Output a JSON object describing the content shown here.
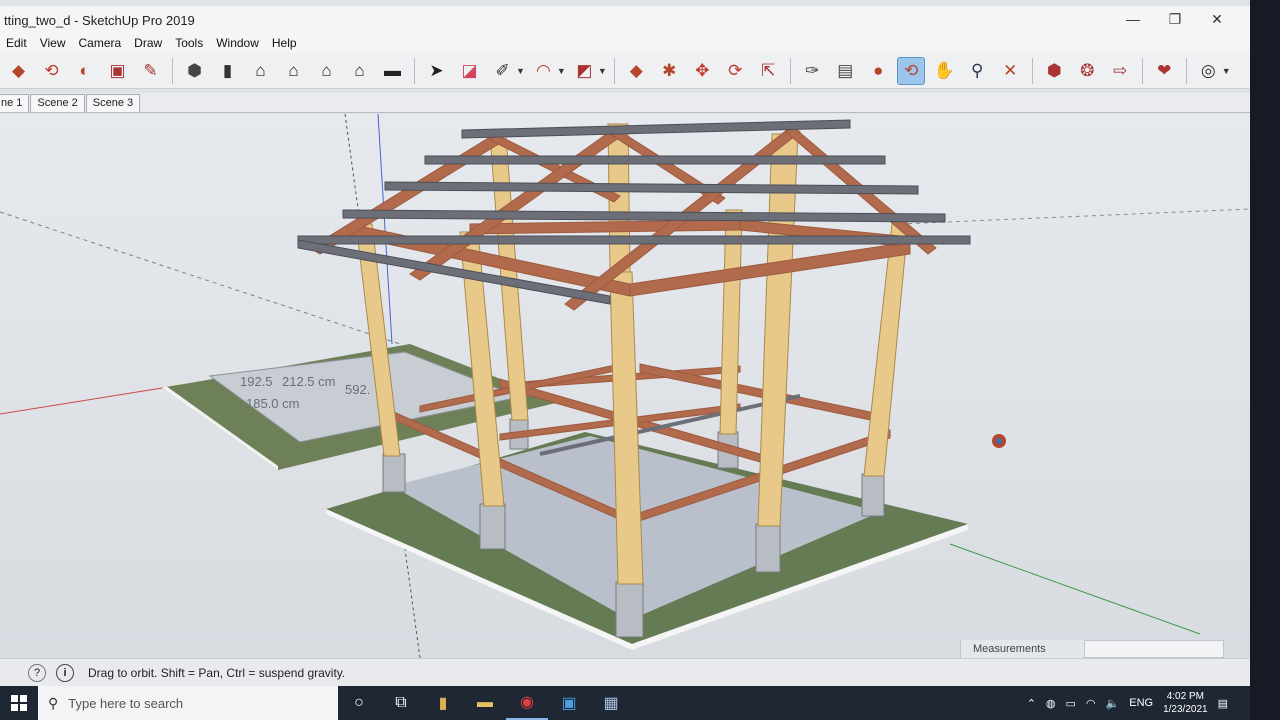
{
  "window": {
    "title": "tting_two_d - SketchUp Pro 2019",
    "controls": [
      "—",
      "❐",
      "✕"
    ]
  },
  "menu": [
    "Edit",
    "View",
    "Camera",
    "Draw",
    "Tools",
    "Window",
    "Help"
  ],
  "toolbar": {
    "icons": [
      "paint-bucket-icon",
      "eraser-icon",
      "pencil-line-icon",
      "arc-icon",
      "rectangle-icon",
      "push-pull-icon",
      "follow-me-icon",
      "move-icon",
      "rotate-icon",
      "scale-icon",
      "tape-measure-icon",
      "text-icon",
      "paint-icon",
      "orbit-icon",
      "pan-icon",
      "zoom-icon",
      "zoom-extents-icon"
    ],
    "active_tool": "orbit"
  },
  "scenes": [
    "ne 1",
    "Scene 2",
    "Scene 3"
  ],
  "viewport": {
    "dimensions": [
      "192.5",
      "212.5 cm",
      "185.0 cm",
      "592."
    ],
    "colors": {
      "sky": "#e4e7eb",
      "ground": "#d7dbe0",
      "pad": "#647a52",
      "post": "#e9c98a",
      "beam": "#b26a4c",
      "purlin": "#6c6e78",
      "footing": "#b7bbc2"
    }
  },
  "measurements": {
    "label": "Measurements",
    "value": ""
  },
  "status": {
    "message": "Drag to orbit. Shift = Pan, Ctrl = suspend gravity."
  },
  "taskbar": {
    "search_placeholder": "Type here to search",
    "language": "ENG",
    "time": "4:02 PM",
    "date": "1/23/2021"
  }
}
